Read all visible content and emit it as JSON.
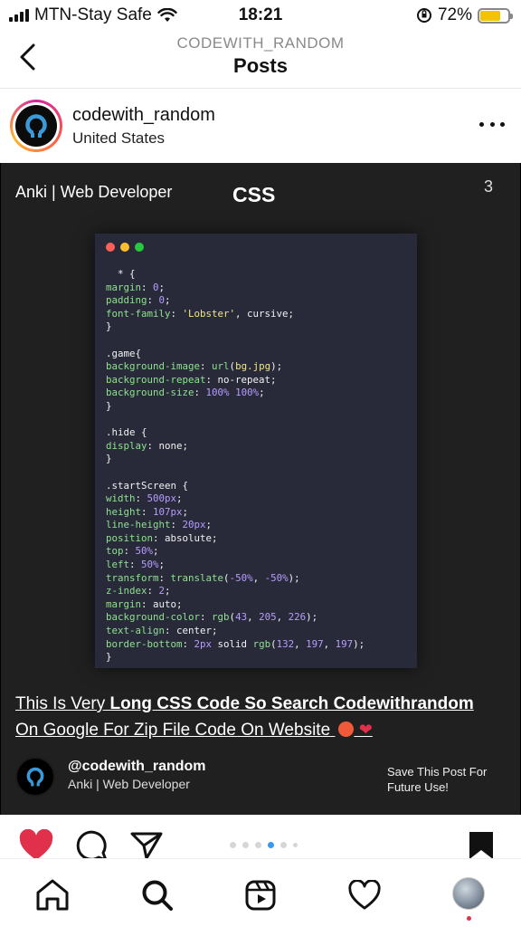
{
  "status_bar": {
    "carrier": "MTN-Stay Safe",
    "time": "18:21",
    "battery": "72%",
    "battery_level": 0.72,
    "battery_color": "#f2c400"
  },
  "header": {
    "subtitle": "CODEWITH_RANDOM",
    "title": "Posts",
    "back_icon": "chevron-left-icon"
  },
  "post": {
    "username": "codewith_random",
    "location": "United States",
    "more_icon": "more-horizontal-icon",
    "image": {
      "author_tag": "Anki | Web Developer",
      "topic": "CSS",
      "page_number": "3",
      "window_dots": [
        "#ff5f56",
        "#ffbd2e",
        "#27c93f"
      ],
      "caption_plain": "This Is Very ",
      "caption_bold_1": "Long CSS Code So Search Codewithrandom",
      "caption_bold_2": "On Google For Zip File Code On Website",
      "footer_handle": "@codewith_random",
      "footer_role": "Anki | Web Developer",
      "save_text_line1": "Save This Post For",
      "save_text_line2": "Future Use!"
    },
    "carousel": {
      "count": 6,
      "active_index": 3
    }
  },
  "actions": {
    "like_icon": "heart-filled-icon",
    "like_color": "#e0304b",
    "comment_icon": "comment-icon",
    "share_icon": "send-icon",
    "bookmark_icon": "bookmark-filled-icon"
  },
  "tab_bar": [
    "home-icon",
    "search-icon",
    "reels-icon",
    "heart-icon",
    "profile-avatar"
  ]
}
